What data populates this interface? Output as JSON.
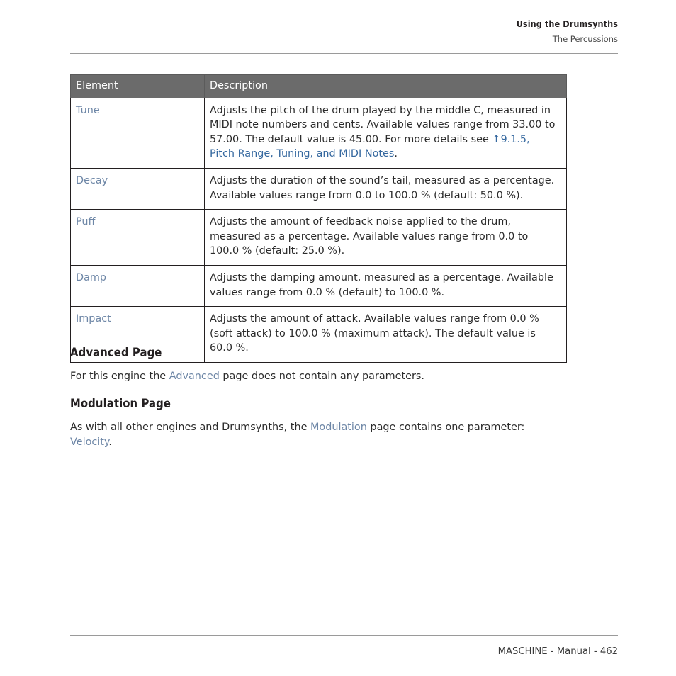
{
  "header": {
    "title": "Using the Drumsynths",
    "subtitle": "The Percussions"
  },
  "table": {
    "columns": [
      "Element",
      "Description"
    ],
    "rows": [
      {
        "element": "Tune",
        "description_parts": [
          {
            "type": "text",
            "value": "Adjusts the pitch of the drum played by the middle C, measured in MIDI note numbers and cents. Available values range from 33.00 to 57.00. The default value is 45.00. For more details see "
          },
          {
            "type": "xref",
            "value": "↑9.1.5, Pitch Range, Tuning, and MIDI Notes"
          },
          {
            "type": "text",
            "value": "."
          }
        ]
      },
      {
        "element": "Decay",
        "description_parts": [
          {
            "type": "text",
            "value": "Adjusts the duration of the sound’s tail, measured as a percentage. Available values range from 0.0 to 100.0 % (default: 50.0 %)."
          }
        ]
      },
      {
        "element": "Puff",
        "description_parts": [
          {
            "type": "text",
            "value": "Adjusts the amount of feedback noise applied to the drum, measured as a percentage. Available values range from 0.0 to 100.0 % (default: 25.0 %)."
          }
        ]
      },
      {
        "element": "Damp",
        "description_parts": [
          {
            "type": "text",
            "value": "Adjusts the damping amount, measured as a percentage. Available values range from 0.0 % (default) to 100.0 %."
          }
        ]
      },
      {
        "element": "Impact",
        "description_parts": [
          {
            "type": "text",
            "value": "Adjusts the amount of attack. Available values range from 0.0 % (soft attack) to 100.0 % (maximum attack). The default value is 60.0 %."
          }
        ]
      }
    ]
  },
  "sections": [
    {
      "heading": "Advanced Page",
      "paragraph_parts": [
        {
          "type": "text",
          "value": "For this engine the "
        },
        {
          "type": "link",
          "value": "Advanced"
        },
        {
          "type": "text",
          "value": " page does not contain any parameters."
        }
      ]
    },
    {
      "heading": "Modulation Page",
      "paragraph_parts": [
        {
          "type": "text",
          "value": "As with all other engines and Drumsynths, the "
        },
        {
          "type": "link",
          "value": "Modulation"
        },
        {
          "type": "text",
          "value": " page contains one parameter: "
        },
        {
          "type": "link",
          "value": "Velocity"
        },
        {
          "type": "text",
          "value": "."
        }
      ]
    }
  ],
  "footer": {
    "text": "MASCHINE - Manual - 462"
  },
  "colors": {
    "table_header_bg": "#6b6b6b",
    "table_link": "#6d86a6",
    "xref_link": "#35689f",
    "body_link": "#6d86a6",
    "rule": "#9a9a9a",
    "text": "#231f20"
  }
}
